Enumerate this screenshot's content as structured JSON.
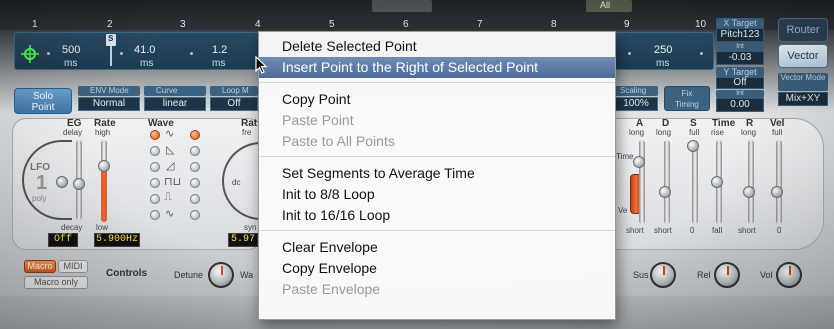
{
  "topbar": {
    "segments": [
      "1",
      "2",
      "3",
      "4",
      "5",
      "6",
      "7",
      "8",
      "9",
      "10"
    ],
    "ghost_label": "All"
  },
  "envelope": {
    "points": [
      {
        "value": "500",
        "unit": "ms"
      },
      {
        "value": "41.0",
        "unit": "ms"
      },
      {
        "value": "1.2",
        "unit": "ms"
      },
      {
        "value": "250",
        "unit": "ms"
      }
    ],
    "marker": "S"
  },
  "targets": {
    "x_header": "X Target",
    "x_value": "Pitch123",
    "int_label": "Int",
    "x_int": "-0.03",
    "y_header": "Y Target",
    "y_value": "Off",
    "y_int_label": "Int",
    "y_int": "0.00",
    "router_button": "Router",
    "vector_button": "Vector",
    "vector_mode_header": "Vector Mode",
    "vector_mode_value": "Mix+XY"
  },
  "selectors": {
    "solo_line1": "Solo",
    "solo_line2": "Point",
    "env_mode_header": "ENV Mode",
    "env_mode_value": "Normal",
    "curve_header": "Curve",
    "curve_value": "linear",
    "loop_header": "Loop M",
    "loop_value": "Off",
    "scaling_header": "Scaling",
    "scaling_value": "100%",
    "fix_line1": "Fix",
    "fix_line2": "Timing"
  },
  "lfo": {
    "eg_label": "EG",
    "eg_sub": "delay",
    "rate_label": "Rate",
    "rate_sub": "high",
    "wave_label": "Wave",
    "lfo_label": "LFO",
    "lfo_number": "1",
    "poly_label": "poly",
    "decay_label": "decay",
    "low_label": "low",
    "off_display": "Off",
    "rate_display": "5.900Hz",
    "rate2_label": "Rat",
    "rate2_sub": "fre",
    "dc_label": "dc",
    "syn_label": "syn",
    "rate2_display": "5.97"
  },
  "env_panel": {
    "a_label": "A",
    "a_sub": "long",
    "d_label": "D",
    "d_sub": "long",
    "s_label": "S",
    "s_sub": "full",
    "time_label": "Time",
    "time_sub": "rise",
    "r_label": "R",
    "r_sub": "long",
    "vel_label": "Vel",
    "vel_sub": "full",
    "bottom_short1": "short",
    "bottom_short2": "short",
    "bottom_zero1": "0",
    "bottom_fall": "fall",
    "bottom_short3": "short",
    "bottom_zero2": "0",
    "side_time": "Time",
    "side_ve": "Ve"
  },
  "controls": {
    "macro": "Macro",
    "midi": "MIDI",
    "macro_only": "Macro only",
    "controls_label": "Controls",
    "detune": "Detune",
    "wa": "Wa",
    "sus": "Sus",
    "rel": "Rel",
    "vol": "Vol"
  },
  "context_menu": {
    "items": [
      {
        "label": "Delete Selected Point",
        "state": "normal"
      },
      {
        "label": "Insert Point to the Right of Selected Point",
        "state": "highlighted"
      },
      {
        "label": "Copy Point",
        "state": "normal"
      },
      {
        "label": "Paste Point",
        "state": "disabled"
      },
      {
        "label": "Paste to All Points",
        "state": "disabled"
      },
      {
        "label": "Set Segments to Average Time",
        "state": "normal"
      },
      {
        "label": "Init to 8/8 Loop",
        "state": "normal"
      },
      {
        "label": "Init to 16/16 Loop",
        "state": "normal"
      },
      {
        "label": "Clear Envelope",
        "state": "normal"
      },
      {
        "label": "Copy Envelope",
        "state": "normal"
      },
      {
        "label": "Paste Envelope",
        "state": "disabled"
      }
    ]
  },
  "colors": {
    "highlight": "#5a77a5",
    "accent_orange": "#e8622a",
    "display_yellow": "#ffe14a"
  }
}
